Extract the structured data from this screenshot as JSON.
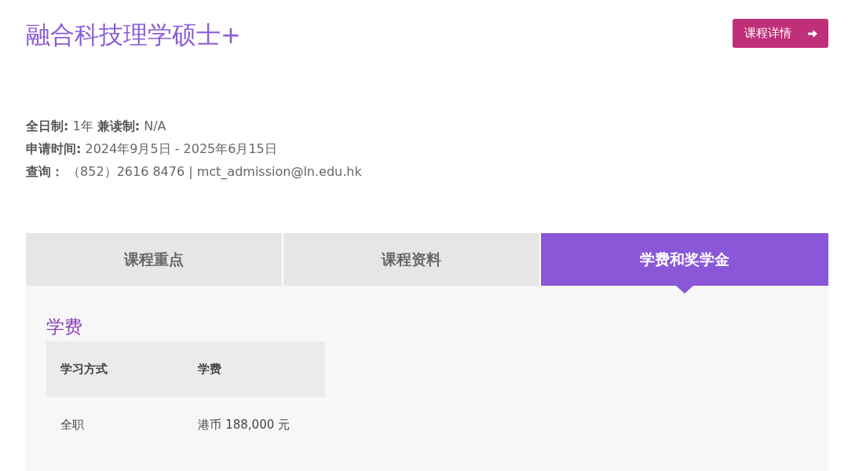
{
  "title": "融合科技理学硕士+",
  "details_button": {
    "label": "课程详情"
  },
  "info_lines": [
    "**全日制:** 1年  **兼读制:** N/A",
    "**申请时间:** 2024年9月5日 - 2025年6月15日",
    "**查询：** （852）2616 8476 | mct_admission@ln.edu.hk"
  ],
  "tabs": [
    {
      "label": "课程重点",
      "selected": false
    },
    {
      "label": "课程资料",
      "selected": false
    },
    {
      "label": "学费和奖学金",
      "selected": true
    }
  ],
  "section_title": "学费",
  "table": {
    "columns": [
      "学习方式",
      "学费"
    ],
    "rows": [
      [
        "全职",
        "港币 188,000 元"
      ]
    ]
  }
}
